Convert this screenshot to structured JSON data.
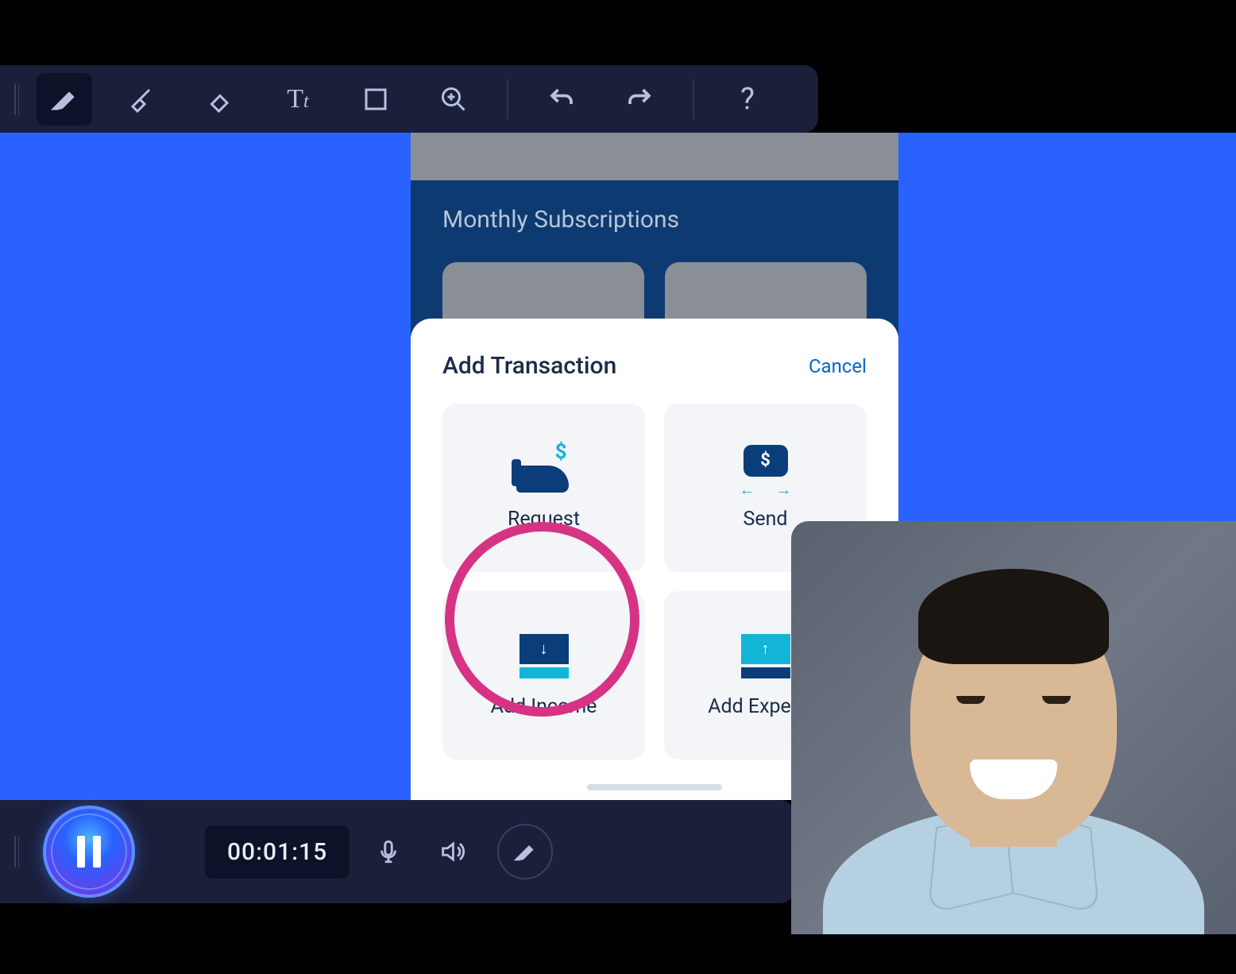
{
  "toolbar": {
    "tools": [
      "pen",
      "highlighter",
      "eraser",
      "text",
      "shape",
      "zoom"
    ],
    "actions": [
      "undo",
      "redo",
      "help"
    ]
  },
  "phone": {
    "section_title": "Monthly Subscriptions",
    "sheet": {
      "title": "Add Transaction",
      "cancel": "Cancel",
      "tiles": {
        "request": "Request",
        "send": "Send",
        "income": "Add Income",
        "expense": "Add Expense"
      }
    }
  },
  "recorder": {
    "timer": "00:01:15"
  }
}
